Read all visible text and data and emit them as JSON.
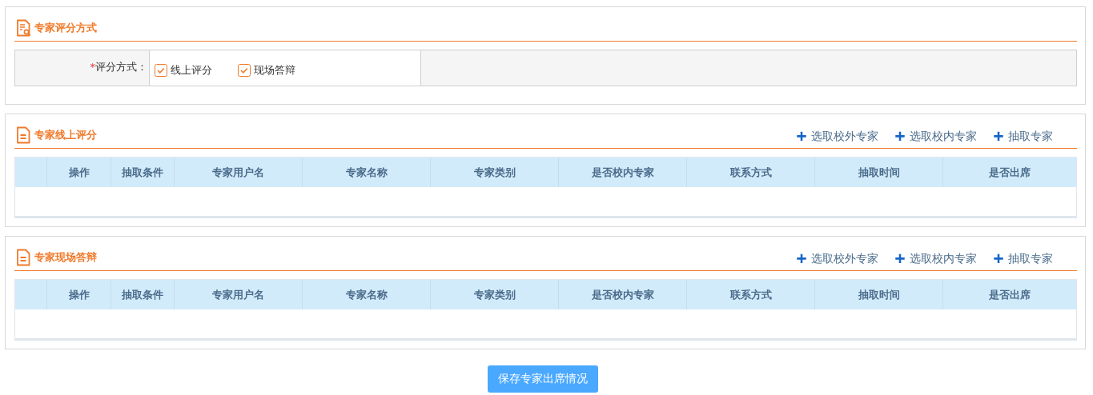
{
  "mode_section": {
    "title": "专家评分方式",
    "field": {
      "required_mark": "*",
      "label": "评分方式：",
      "options": [
        {
          "label": "线上评分",
          "checked": true
        },
        {
          "label": "现场答辩",
          "checked": true
        }
      ]
    }
  },
  "table_sections": [
    {
      "title": "专家线上评分",
      "actions": [
        "选取校外专家",
        "选取校内专家",
        "抽取专家"
      ],
      "columns": [
        "操作",
        "抽取条件",
        "专家用户名",
        "专家名称",
        "专家类别",
        "是否校内专家",
        "联系方式",
        "抽取时间",
        "是否出席"
      ]
    },
    {
      "title": "专家现场答辩",
      "actions": [
        "选取校外专家",
        "选取校内专家",
        "抽取专家"
      ],
      "columns": [
        "操作",
        "抽取条件",
        "专家用户名",
        "专家名称",
        "专家类别",
        "是否校内专家",
        "联系方式",
        "抽取时间",
        "是否出席"
      ]
    }
  ],
  "save_button": "保存专家出席情况"
}
